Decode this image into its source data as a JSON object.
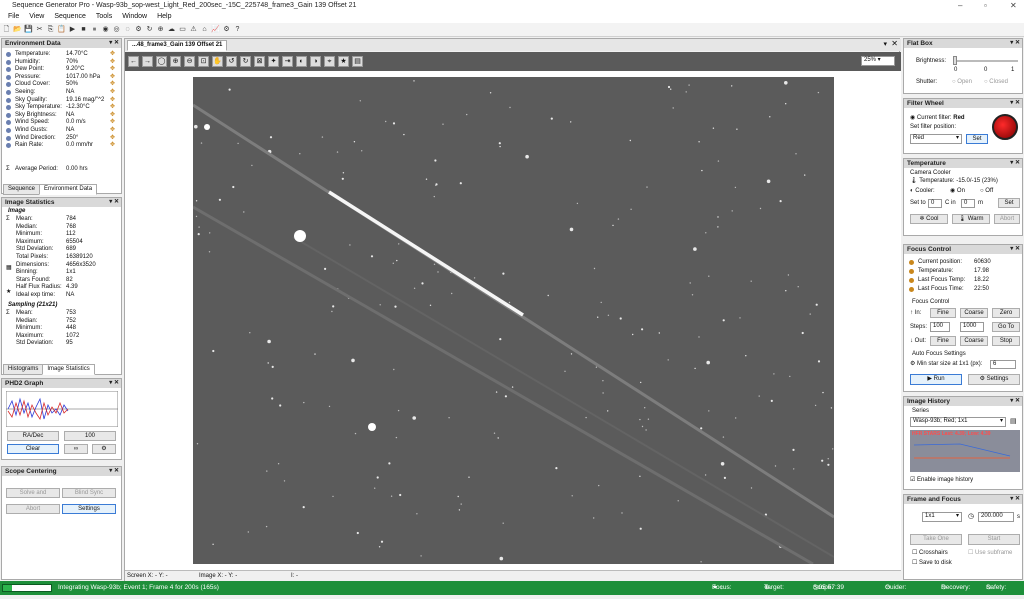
{
  "title": "Sequence Generator Pro - Wasp-93b_sop-west_Light_Red_200sec_-15C_225748_frame3_Gain 139 Offset 21",
  "menu": [
    "File",
    "View",
    "Sequence",
    "Tools",
    "Window",
    "Help"
  ],
  "env": {
    "header": "Environment Data",
    "rows": [
      {
        "k": "Temperature:",
        "v": "14.70°C"
      },
      {
        "k": "Humidity:",
        "v": "70%"
      },
      {
        "k": "Dew Point:",
        "v": "9.20°C"
      },
      {
        "k": "Pressure:",
        "v": "1017.00 hPa"
      },
      {
        "k": "Cloud Cover:",
        "v": "50%"
      },
      {
        "k": "Seeing:",
        "v": "NA"
      },
      {
        "k": "Sky Quality:",
        "v": "19.16 mag/\"^2"
      },
      {
        "k": "Sky Temperature:",
        "v": "-12.30°C"
      },
      {
        "k": "Sky Brightness:",
        "v": "NA"
      },
      {
        "k": "Wind Speed:",
        "v": "0.0 m/s"
      },
      {
        "k": "Wind Gusts:",
        "v": "NA"
      },
      {
        "k": "Wind Direction:",
        "v": "250°"
      },
      {
        "k": "Rain Rate:",
        "v": "0.0 mm/hr"
      }
    ],
    "avg_label": "Average Period:",
    "avg_value": "0.00 hrs",
    "tabs": [
      "Sequence",
      "Environment Data"
    ]
  },
  "stats": {
    "header": "Image Statistics",
    "image_title": "Image",
    "image": [
      {
        "k": "Mean:",
        "v": "784"
      },
      {
        "k": "Median:",
        "v": "768"
      },
      {
        "k": "Minimum:",
        "v": "112"
      },
      {
        "k": "Maximum:",
        "v": "65504"
      },
      {
        "k": "Std Deviation:",
        "v": "689"
      },
      {
        "k": "Total Pixels:",
        "v": "16389120"
      },
      {
        "k": "Dimensions:",
        "v": "4656x3520"
      },
      {
        "k": "Binning:",
        "v": "1x1"
      },
      {
        "k": "Stars Found:",
        "v": "82"
      },
      {
        "k": "Half Flux Radius:",
        "v": "4.39"
      },
      {
        "k": "Ideal exp time:",
        "v": "NA"
      }
    ],
    "sampling_title": "Sampling (21x21)",
    "sampling": [
      {
        "k": "Mean:",
        "v": "753"
      },
      {
        "k": "Median:",
        "v": "752"
      },
      {
        "k": "Minimum:",
        "v": "448"
      },
      {
        "k": "Maximum:",
        "v": "1072"
      },
      {
        "k": "Std Deviation:",
        "v": "95"
      }
    ],
    "tabs": [
      "Histograms",
      "Image Statistics"
    ]
  },
  "phd2": {
    "header": "PHD2 Graph",
    "radec": "RA/Dec",
    "count": "100",
    "clear": "Clear"
  },
  "scope": {
    "header": "Scope Centering",
    "solve": "Solve and",
    "blind": "Blind Sync",
    "abort": "Abort",
    "settings": "Settings"
  },
  "doc": {
    "tab": "...48_frame3_Gain 139 Offset 21",
    "zoom": "25%"
  },
  "coords": {
    "screen": "Screen X: - Y: -",
    "image": "Image X: - Y: -",
    "i": "I: -"
  },
  "flatbox": {
    "header": "Flat Box",
    "brightness": "Brightness:",
    "b0": "0",
    "b1": "0",
    "b2": "1",
    "shutter": "Shutter:",
    "open": "Open",
    "closed": "Closed"
  },
  "filter": {
    "header": "Filter Wheel",
    "current_label": "Current filter:",
    "current": "Red",
    "set_pos": "Set filter position:",
    "select": "Red",
    "set": "Set"
  },
  "temp": {
    "header": "Temperature",
    "cooler_title": "Camera Cooler",
    "temp_line": "Temperature: -15.0/-15 (23%)",
    "cooler": "Cooler:",
    "on": "On",
    "off": "Off",
    "set_to": "Set to",
    "set_val": "0",
    "c_in": "C in",
    "min_val": "0",
    "m": "m",
    "set": "Set",
    "cool": "Cool",
    "warm": "Warm",
    "abort": "Abort"
  },
  "focus": {
    "header": "Focus Control",
    "rows": [
      {
        "k": "Current position:",
        "v": "60630"
      },
      {
        "k": "Temperature:",
        "v": "17.98"
      },
      {
        "k": "Last Focus Temp:",
        "v": "18.22"
      },
      {
        "k": "Last Focus Time:",
        "v": "22:50"
      }
    ],
    "fc_title": "Focus Control",
    "in": "In:",
    "fine": "Fine",
    "coarse": "Coarse",
    "zero": "Zero",
    "steps": "Steps:",
    "s1": "100",
    "s2": "1000",
    "goto": "Go To",
    "out": "Out:",
    "stop": "Stop",
    "af_title": "Auto Focus Settings",
    "minstar": "Min star size at 1x1 (px):",
    "minstar_v": "6",
    "run": "Run",
    "settings": "Settings"
  },
  "history": {
    "header": "Image History",
    "series_label": "Series",
    "series": "Wasp-93b; Red; 1x1",
    "legend": "HFR  STARS    Last: 4.39; Low: 4.39",
    "enable": "Enable image history"
  },
  "frame": {
    "header": "Frame and Focus",
    "bin": "1x1",
    "exp": "200.000",
    "unit": "s",
    "take": "Take One",
    "start": "Start",
    "crosshairs": "Crosshairs",
    "subframe": "Use subframe",
    "save": "Save to disk"
  },
  "statusbar": {
    "text": "Integrating Wasp-93b; Event 1; Frame 4 for 200s (165s)",
    "focus": "Focus:",
    "target": "Target:",
    "scope": "Scope:",
    "time": "05:57:39",
    "guider": "Guider:",
    "recovery": "Recovery:",
    "safety": "Safety:"
  },
  "colors": {
    "status": "#1e8f3a",
    "image_bg": "#5b5b5b"
  }
}
